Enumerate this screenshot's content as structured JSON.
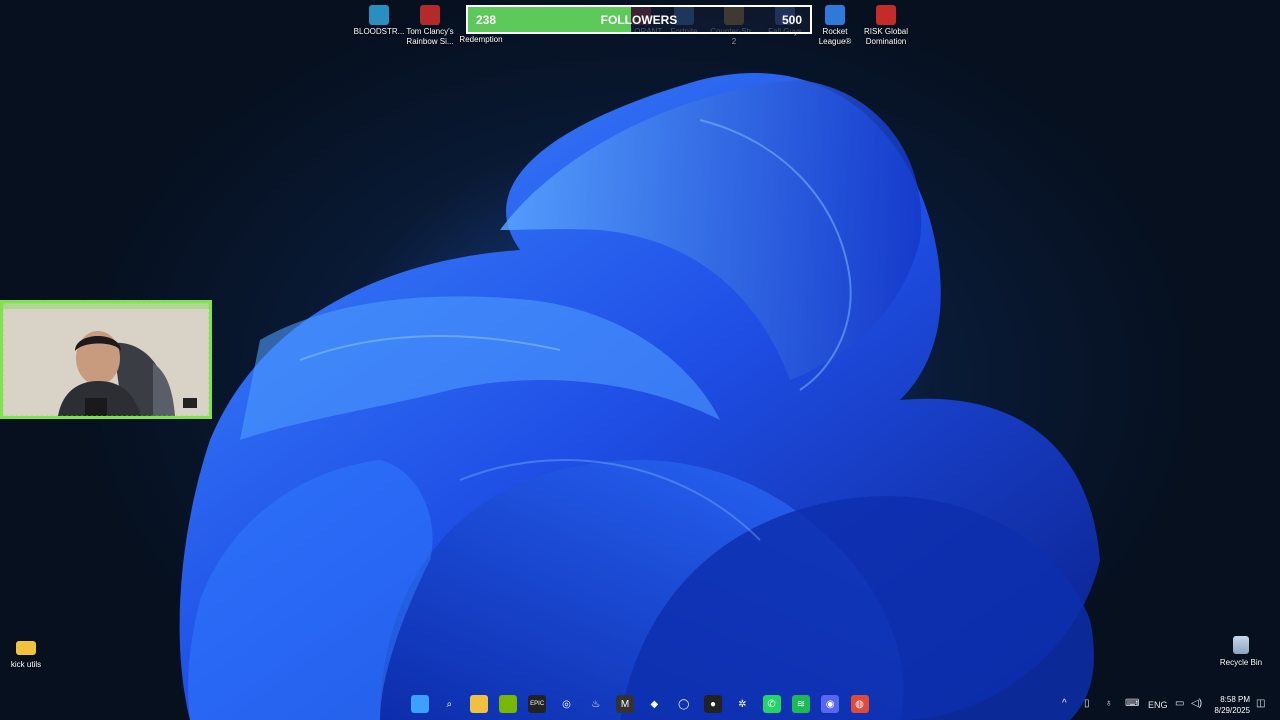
{
  "desktop_icons_top": [
    {
      "label": "BLOODSTR...",
      "icon": "bloodstrike-icon",
      "color": "#2a8fbf"
    },
    {
      "label": "Tom Clancy's Rainbow Si...",
      "icon": "rainbow-six-icon",
      "color": "#b22a2a"
    },
    {
      "label": "Redemption",
      "icon": "redemption-icon",
      "color": "#4a3a2a"
    },
    {
      "label": "VALORANT",
      "icon": "valorant-icon",
      "color": "#c23a3a"
    },
    {
      "label": "Fortnite",
      "icon": "fortnite-icon",
      "color": "#4a8fd6"
    },
    {
      "label": "Counter-Str... 2",
      "icon": "cs2-icon",
      "color": "#c99a3a"
    },
    {
      "label": "Fall Guys",
      "icon": "fall-guys-icon",
      "color": "#5a7ad6"
    },
    {
      "label": "Rocket League®",
      "icon": "rocket-league-icon",
      "color": "#2f7ad8"
    },
    {
      "label": "RISK Global Domination",
      "icon": "risk-icon",
      "color": "#c42b2b"
    }
  ],
  "followers_widget": {
    "count": "238",
    "title": "FOLLOWERS",
    "goal": "500",
    "progress": 0.476,
    "fill_color": "#5cc95a"
  },
  "desktop_icons_bottom": {
    "kick_utils": {
      "label": "kick utils",
      "icon": "folder-icon"
    },
    "recycle_bin": {
      "label": "Recycle Bin",
      "icon": "recycle-bin-icon"
    }
  },
  "taskbar_apps": [
    {
      "name": "start-button",
      "glyph": "",
      "color": "#3ba0ff"
    },
    {
      "name": "search-icon",
      "glyph": "⌕",
      "color": "transparent"
    },
    {
      "name": "file-explorer-icon",
      "glyph": "",
      "color": "#f0c040"
    },
    {
      "name": "nvidia-icon",
      "glyph": "",
      "color": "#76b900"
    },
    {
      "name": "epic-games-icon",
      "glyph": "EPIC",
      "color": "#222222"
    },
    {
      "name": "obs-icon",
      "glyph": "◎",
      "color": "transparent"
    },
    {
      "name": "steam-icon",
      "glyph": "♨",
      "color": "transparent"
    },
    {
      "name": "app-m-icon",
      "glyph": "M",
      "color": "#333333"
    },
    {
      "name": "gamepad-icon",
      "glyph": "◆",
      "color": "transparent"
    },
    {
      "name": "oculus-icon",
      "glyph": "◯",
      "color": "transparent"
    },
    {
      "name": "obs-studio-icon",
      "glyph": "●",
      "color": "#222222"
    },
    {
      "name": "chatgpt-icon",
      "glyph": "✲",
      "color": "transparent"
    },
    {
      "name": "whatsapp-icon",
      "glyph": "✆",
      "color": "#25d366"
    },
    {
      "name": "spotify-icon",
      "glyph": "≋",
      "color": "#1db954"
    },
    {
      "name": "discord-icon",
      "glyph": "◉",
      "color": "#5865f2"
    },
    {
      "name": "chrome-icon",
      "glyph": "◍",
      "color": "#e04a3a"
    }
  ],
  "tray": {
    "chevron": "^",
    "language": "ENG"
  },
  "clock": {
    "time": "8:58 PM",
    "date": "8/29/2025"
  }
}
